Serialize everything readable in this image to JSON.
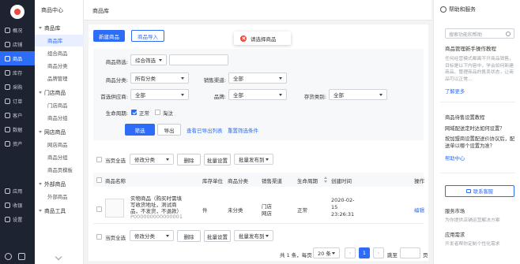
{
  "nav": {
    "items": [
      {
        "label": "概况",
        "icon": "home-icon"
      },
      {
        "label": "店铺",
        "icon": "store-icon"
      },
      {
        "label": "商品",
        "icon": "goods-icon"
      },
      {
        "label": "库存",
        "icon": "inventory-icon"
      },
      {
        "label": "采购",
        "icon": "purchase-icon"
      },
      {
        "label": "订单",
        "icon": "order-icon"
      },
      {
        "label": "客户",
        "icon": "customer-icon"
      },
      {
        "label": "数据",
        "icon": "data-icon"
      },
      {
        "label": "资产",
        "icon": "asset-icon"
      },
      {
        "label": "应用",
        "icon": "apps-icon"
      },
      {
        "label": "收银",
        "icon": "cashier-icon"
      },
      {
        "label": "设置",
        "icon": "settings-icon"
      }
    ],
    "bottom_icons": [
      "search-icon",
      "message-icon"
    ]
  },
  "subnav": {
    "title": "商品中心",
    "groups": [
      {
        "label": "商品库",
        "items": [
          "商品库",
          "组合商品",
          "商品分类",
          "品牌管理"
        ]
      },
      {
        "label": "门店商品",
        "items": [
          "门店商品",
          "商品分组"
        ]
      },
      {
        "label": "网店商品",
        "items": [
          "网店商品",
          "商品分组",
          "商品页模板"
        ]
      },
      {
        "label": "外部商品",
        "items": [
          "外部商品"
        ]
      },
      {
        "label": "商品工具",
        "items": []
      }
    ]
  },
  "breadcrumb": "商品库",
  "toolbar": {
    "new_label": "新建商品",
    "import_label": "商品导入"
  },
  "toast": {
    "message": "请选择商品"
  },
  "filters": {
    "search_label": "商品筛选:",
    "search_type": "综合筛选",
    "category_label": "商品分类:",
    "category_value": "所有分类",
    "channel_label": "销售渠道:",
    "channel_value": "全部",
    "supplier_label": "首选供应商:",
    "supplier_value": "全部",
    "brand_label": "品牌:",
    "brand_value": "全部",
    "stock_type_label": "存货类别:",
    "stock_type_value": "全部",
    "lifecycle_label": "生命周期:",
    "lifecycle_options": [
      {
        "label": "正常",
        "checked": true
      },
      {
        "label": "淘汰",
        "checked": false
      }
    ],
    "filter_button": "筛选",
    "export_button": "导出",
    "view_export_link": "查看已导出列表",
    "reset_link": "重置筛选条件"
  },
  "bulk_actions": {
    "select_page": "当页全选",
    "modify_category": "修改分类",
    "delete": "删除",
    "batch_setting": "批量设置",
    "batch_publish": "批量发布到"
  },
  "table": {
    "columns": [
      "商品名称",
      "库存单位",
      "商品分类",
      "销售渠道",
      "生命周期",
      "创建时间",
      "操作"
    ],
    "rows": [
      {
        "name_lines": [
          "实物商品（购买时需填",
          "写收货地址，测试商",
          "品，不发货，不退款）"
        ],
        "code": "P000000000000001",
        "unit": "件",
        "category": "未分类",
        "channel_lines": [
          "门店",
          "网店"
        ],
        "lifecycle": "正常",
        "created_lines": [
          "2020-02-",
          "15",
          "23:26:31"
        ],
        "action": "编辑"
      }
    ]
  },
  "pagination": {
    "summary": "共 1 条，每页",
    "page_size": "20 条",
    "current_page": "1",
    "goto_label": "跳至",
    "page_suffix": "页"
  },
  "help": {
    "title": "帮助和服务",
    "search_placeholder": "搜索功能和帮助",
    "section1_title": "商品管理新手操作教程",
    "section1_desc": "任何经营模式都离不开商品销售，目标是以下内容中，学会如何新建商品、管理商品的售卖状态，让商品可以正常...",
    "learn_more": "了解更多",
    "section2_title": "商品待售设置教程",
    "q1": "网域配送定时达如何设置？",
    "q2": "按加盟商设置配送价协议后，配送单以哪个设置为准？",
    "help_center": "帮助中心",
    "contact_button": "联系客服",
    "service_market": "服务市场",
    "service_market_desc": "为你提供店铺运营解决方案",
    "app_demand": "应用需求",
    "app_demand_desc": "开发者帮你定制个性化需求"
  }
}
